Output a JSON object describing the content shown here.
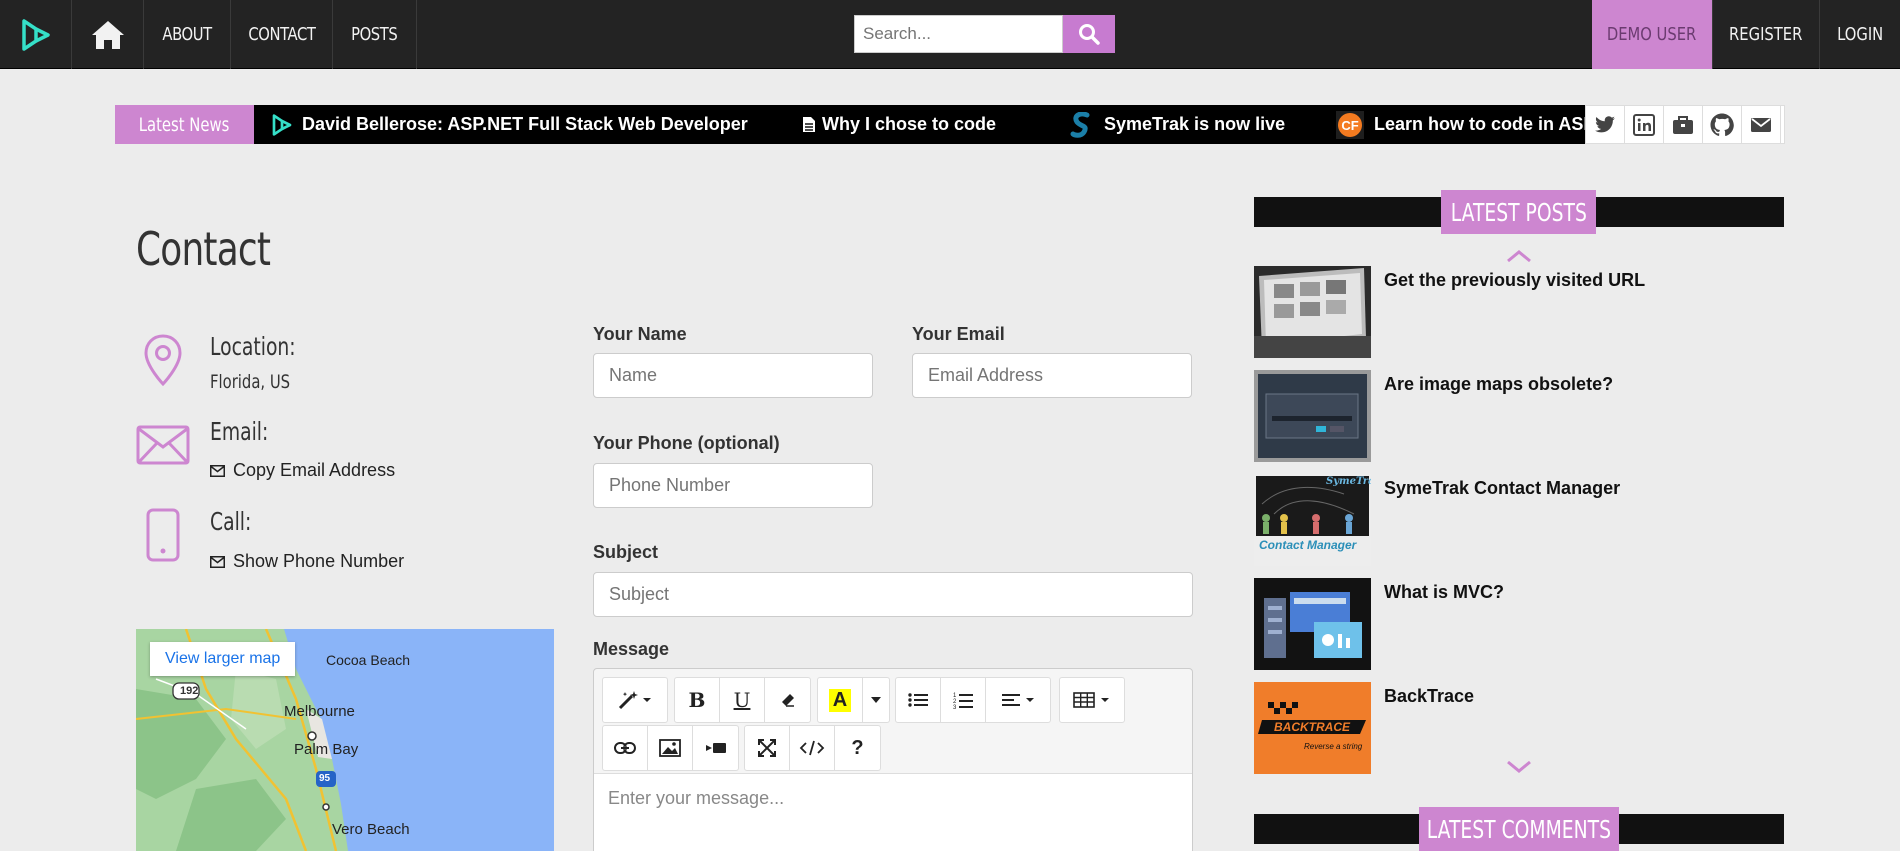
{
  "nav": {
    "about": "ABOUT",
    "contact": "CONTACT",
    "posts": "POSTS",
    "search_placeholder": "Search...",
    "demo_user": "DEMO USER",
    "register": "REGISTER",
    "login": "LOGIN"
  },
  "ticker": {
    "label": "Latest News",
    "items": [
      "David Bellerose: ASP.NET Full Stack Web Developer",
      "Why I chose to code",
      "SymeTrak is now live",
      "Learn how to code in ASP.NET"
    ]
  },
  "contact": {
    "title": "Contact",
    "location_label": "Location:",
    "location_value": "Florida, US",
    "email_label": "Email:",
    "email_link": "Copy Email Address",
    "call_label": "Call:",
    "call_link": "Show Phone Number",
    "map_link": "View larger map",
    "map_places": [
      "Cocoa Beach",
      "Melbourne",
      "Palm Bay",
      "Vero Beach",
      "192",
      "95"
    ]
  },
  "form": {
    "name_label": "Your Name",
    "name_placeholder": "Name",
    "email_label": "Your Email",
    "email_placeholder": "Email Address",
    "phone_label": "Your Phone (optional)",
    "phone_placeholder": "Phone Number",
    "subject_label": "Subject",
    "subject_placeholder": "Subject",
    "message_label": "Message",
    "message_placeholder": "Enter your message..."
  },
  "sidebar": {
    "latest_posts": "LATEST POSTS",
    "latest_comments": "LATEST COMMENTS",
    "posts": [
      {
        "title": "Get the previously visited URL"
      },
      {
        "title": "Are image maps obsolete?"
      },
      {
        "title": "SymeTrak Contact Manager"
      },
      {
        "title": "What is MVC?"
      },
      {
        "title": "BackTrace"
      }
    ],
    "thumb_text": {
      "symetrak_logo": "SymeTrak",
      "symetrak_caption": "Contact Manager",
      "backtrace_logo": "BACKTRACE",
      "backtrace_caption": "Reverse a string"
    }
  },
  "colors": {
    "accent": "#cd86d0",
    "navbar": "#232323",
    "logo": "#35e0c8"
  }
}
